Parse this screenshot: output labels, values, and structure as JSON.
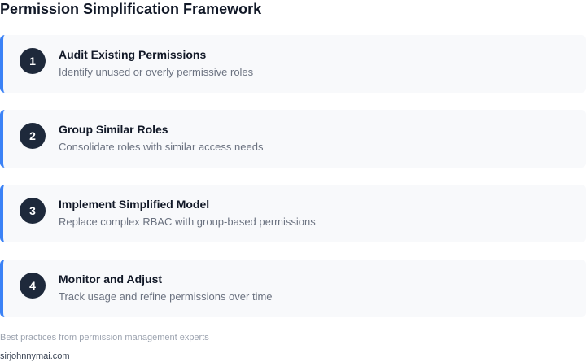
{
  "title": "Permission Simplification Framework",
  "accent_color": "#3b82f6",
  "badge_color": "#1e293b",
  "steps": [
    {
      "number": "1",
      "title": "Audit Existing Permissions",
      "description": "Identify unused or overly permissive roles"
    },
    {
      "number": "2",
      "title": "Group Similar Roles",
      "description": "Consolidate roles with similar access needs"
    },
    {
      "number": "3",
      "title": "Implement Simplified Model",
      "description": "Replace complex RBAC with group-based permissions"
    },
    {
      "number": "4",
      "title": "Monitor and Adjust",
      "description": "Track usage and refine permissions over time"
    }
  ],
  "footnote": "Best practices from permission management experts",
  "source": "sirjohnnymai.com"
}
